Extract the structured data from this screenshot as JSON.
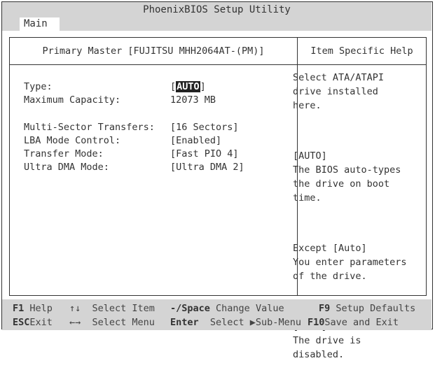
{
  "app_title": "PhoenixBIOS Setup Utility",
  "tabs": [
    {
      "label": "Main",
      "active": true
    }
  ],
  "panel": {
    "header": "Primary Master [FUJITSU MHH2064AT-(PM)]",
    "help_header": "Item Specific Help",
    "fields": [
      {
        "label": "Type:",
        "open": "[",
        "value": "AUTO",
        "close": "]",
        "selected": true
      },
      {
        "label": "Maximum Capacity:",
        "value": "12073 MB"
      },
      {
        "label": "Multi-Sector Transfers:",
        "value": "[16 Sectors]"
      },
      {
        "label": "LBA Mode Control:",
        "value": "[Enabled]"
      },
      {
        "label": "Transfer Mode:",
        "value": "[Fast PIO 4]"
      },
      {
        "label": "Ultra DMA Mode:",
        "value": "[Ultra DMA 2]"
      }
    ],
    "help_text": [
      "Select ATA/ATAPI\ndrive installed\nhere.",
      "[AUTO]\nThe BIOS auto-types\nthe drive on boot\ntime.",
      "Except [Auto]\nYou enter parameters\nof the drive.",
      "[None]\nThe drive is\ndisabled."
    ]
  },
  "footer": {
    "row1": [
      {
        "key": "F1",
        "label": "Help"
      },
      {
        "key": "↑↓",
        "label": "Select Item"
      },
      {
        "key": "-/Space",
        "label": "Change Value"
      },
      {
        "key": "F9",
        "label": "Setup Defaults"
      }
    ],
    "row2": [
      {
        "key": "ESC",
        "label": "Exit"
      },
      {
        "key": "←→",
        "label": "Select Menu"
      },
      {
        "key": "Enter",
        "label": "Select ▶Sub-Menu"
      },
      {
        "key": "F10",
        "label": "Save and Exit"
      }
    ]
  },
  "colors": {
    "background": "#ffffff",
    "bar": "#d4d4d4",
    "text": "#333333",
    "highlight_bg": "#222222"
  }
}
